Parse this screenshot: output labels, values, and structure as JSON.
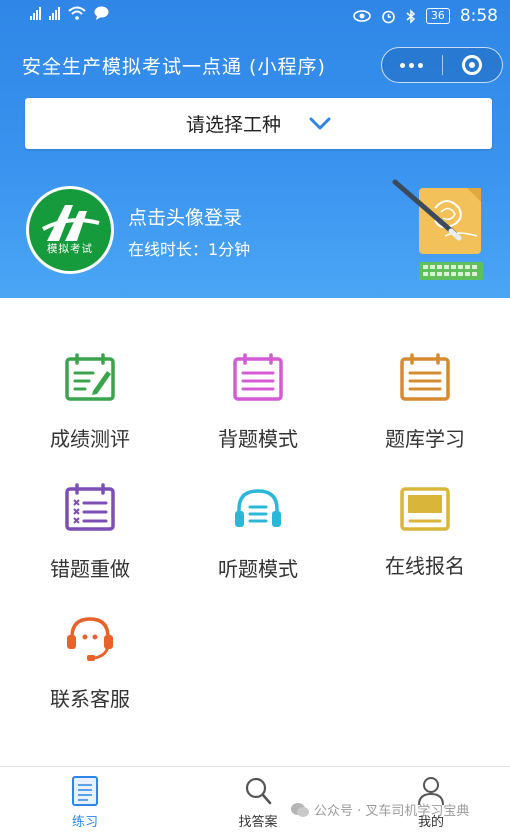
{
  "status_bar": {
    "battery": "36",
    "time": "8:58"
  },
  "header": {
    "title": "安全生产模拟考试一点通 (小程序)"
  },
  "selector": {
    "label": "请选择工种"
  },
  "user": {
    "avatar_caption": "模拟考试",
    "login_prompt": "点击头像登录",
    "online_time": "在线时长：1分钟"
  },
  "menu": {
    "items": [
      {
        "label": "成绩测评",
        "icon": "score-sheet-icon",
        "color": "#3aa44c"
      },
      {
        "label": "背题模式",
        "icon": "recite-list-icon",
        "color": "#d45bd4"
      },
      {
        "label": "题库学习",
        "icon": "question-bank-icon",
        "color": "#d88a2e"
      },
      {
        "label": "错题重做",
        "icon": "wrong-questions-icon",
        "color": "#7b4fb5"
      },
      {
        "label": "听题模式",
        "icon": "headphones-icon",
        "color": "#2bb8d8"
      },
      {
        "label": "在线报名",
        "icon": "signup-badge-icon",
        "color": "#d9b63a"
      },
      {
        "label": "联系客服",
        "icon": "customer-service-icon",
        "color": "#e8632a"
      }
    ]
  },
  "tabbar": {
    "tabs": [
      {
        "label": "练习",
        "icon": "practice-icon"
      },
      {
        "label": "找答案",
        "icon": "search-icon"
      },
      {
        "label": "我的",
        "icon": "profile-icon"
      }
    ]
  },
  "watermark": {
    "text": "公众号 · 叉车司机学习宝典"
  },
  "colors": {
    "primary": "#2f86e6",
    "avatar_green": "#159a3c"
  }
}
